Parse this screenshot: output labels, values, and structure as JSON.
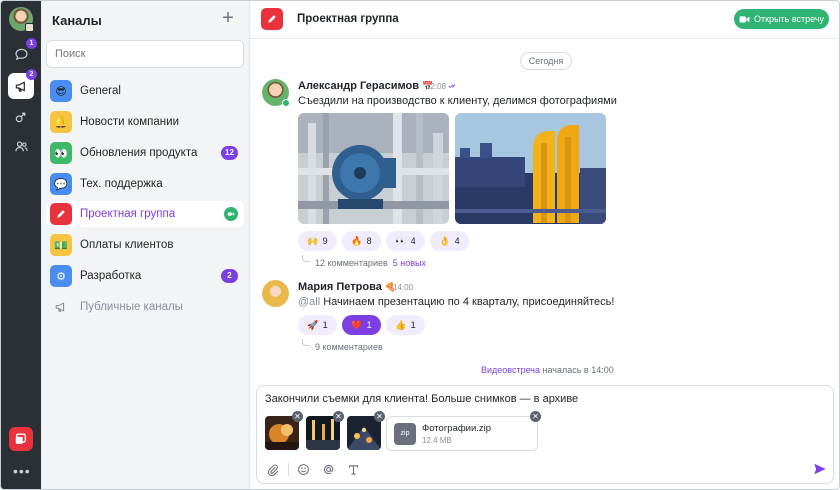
{
  "rail": {
    "badge_chat": "1",
    "badge_channels": "2",
    "more": "•••"
  },
  "channels": {
    "title": "Каналы",
    "add": "+",
    "search_placeholder": "Поиск",
    "items": [
      {
        "label": "General",
        "icon": "sunglasses-emoji-icon",
        "icon_glyph": "😎",
        "color": "#4a8df0"
      },
      {
        "label": "Новости компании",
        "icon": "bell-icon",
        "icon_glyph": "🔔",
        "color": "#f5c542"
      },
      {
        "label": "Обновления продукта",
        "icon": "eyes-emoji-icon",
        "icon_glyph": "👀",
        "color": "#3fb86a",
        "count": "12"
      },
      {
        "label": "Тех. поддержка",
        "icon": "speech-bubble-icon",
        "icon_glyph": "💬",
        "color": "#4a8df0"
      },
      {
        "label": "Проектная группа",
        "icon": "pencil-icon",
        "icon_glyph": "✏",
        "color": "#e8323c"
      },
      {
        "label": "Оплаты клиентов",
        "icon": "money-icon",
        "icon_glyph": "💵",
        "color": "#f5c542"
      },
      {
        "label": "Разработка",
        "icon": "gear-icon",
        "icon_glyph": "⚙",
        "color": "#4a8df0",
        "count": "2"
      }
    ],
    "public_label": "Публичные каналы"
  },
  "header": {
    "title": "Проектная группа",
    "meet_button": "Открыть встречу"
  },
  "chat": {
    "date_divider": "Сегодня",
    "messages": [
      {
        "author": "Александр Герасимов",
        "status_emoji": "📅",
        "time": "12:08",
        "text": "Съездили на производство к клиенту, делимся фотографиями",
        "reactions": [
          {
            "emoji": "🙌",
            "count": "9"
          },
          {
            "emoji": "🔥",
            "count": "8"
          },
          {
            "emoji": "👀",
            "count": "4"
          },
          {
            "emoji": "👌",
            "count": "4"
          }
        ],
        "thread_count": "12 комментариев",
        "thread_new": "5 новых"
      },
      {
        "author": "Мария Петрова",
        "status_emoji": "🍕",
        "time": "14:00",
        "mention": "@all",
        "text": " Начинаем презентацию по 4 кварталу, присоединяйтесь!",
        "reactions": [
          {
            "emoji": "🚀",
            "count": "1"
          },
          {
            "emoji": "❤️",
            "count": "1",
            "mine": true
          },
          {
            "emoji": "👍",
            "count": "1"
          }
        ],
        "thread_count": "9 комментариев"
      }
    ],
    "system_link": "Видеовстреча",
    "system_text": " началась в 14:00"
  },
  "composer": {
    "text": "Закончили съемки для клиента! Больше снимков — в архиве",
    "file_ext": "zip",
    "file_name": "Фотографии.zip",
    "file_size": "12.4 MB"
  },
  "colors": {
    "accent": "#7b3fe4",
    "green": "#2fb474",
    "red": "#e8323c",
    "rail": "#2b2f36"
  }
}
